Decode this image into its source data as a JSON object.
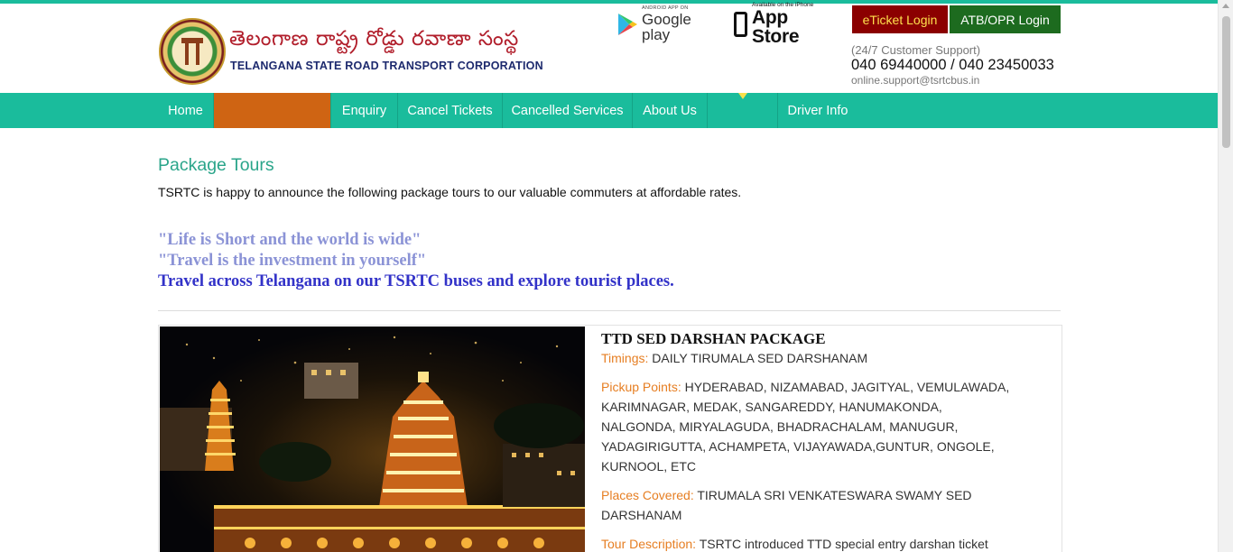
{
  "header": {
    "brand_telugu": "తెలంగాణ రాష్ట్ర రోడ్డు రవాణా సంస్థ",
    "brand_english": "TELANGANA STATE ROAD TRANSPORT CORPORATION",
    "google_play": {
      "small": "ANDROID APP ON",
      "big": "Google play"
    },
    "app_store": {
      "small": "Available on the iPhone",
      "big": "App Store"
    },
    "eticket_label": "eTicket Login",
    "atb_label": "ATB/OPR Login",
    "support_label": "(24/7 Customer Support)",
    "support_phones": "040 69440000 / 040 23450033",
    "support_email": "online.support@tsrtcbus.in"
  },
  "nav": {
    "items": [
      {
        "label": "Home"
      },
      {
        "label": ""
      },
      {
        "label": "Enquiry"
      },
      {
        "label": "Cancel Tickets"
      },
      {
        "label": "Cancelled Services"
      },
      {
        "label": "About Us"
      },
      {
        "label": ""
      },
      {
        "label": "Driver Info"
      }
    ]
  },
  "main": {
    "title": "Package Tours",
    "intro": "TSRTC is happy to announce the following package tours to our valuable commuters at affordable rates.",
    "quote1": "\"Life is Short and the world is wide\"",
    "quote2": "\"Travel is the investment in yourself\"",
    "quote3": "Travel across Telangana on our TSRTC buses and explore tourist places."
  },
  "package": {
    "title": "TTD SED DARSHAN PACKAGE",
    "timings_label": "Timings:",
    "timings": "DAILY TIRUMALA SED DARSHANAM",
    "pickup_label": "Pickup Points:",
    "pickup_l1": "HYDERABAD, NIZAMABAD, JAGITYAL, VEMULAWADA,",
    "pickup_l2": "KARIMNAGAR, MEDAK, SANGAREDDY, HANUMAKONDA,",
    "pickup_l3": "NALGONDA, MIRYALAGUDA, BHADRACHALAM, MANUGUR,",
    "pickup_l4": "YADAGIRIGUTTA, ACHAMPETA, VIJAYAWADA,GUNTUR, ONGOLE,",
    "pickup_l5": "KURNOOL, ETC",
    "places_label": "Places Covered:",
    "places_l1": "TIRUMALA SRI VENKATESWARA SWAMY SED",
    "places_l2": "DARSHANAM",
    "desc_label": "Tour Description:",
    "desc": "TSRTC introduced TTD special entry darshan ticket"
  },
  "colors": {
    "nav_bg": "#1abc9c",
    "nav_orange": "#cf6413",
    "eticket_bg": "#8b0000",
    "eticket_text": "#ffe14d",
    "atb_bg": "#1d6b1f",
    "title_green": "#2aa58a",
    "label_orange": "#e67e22",
    "quote_light": "#8b93d6",
    "quote_dark": "#3232c8"
  }
}
